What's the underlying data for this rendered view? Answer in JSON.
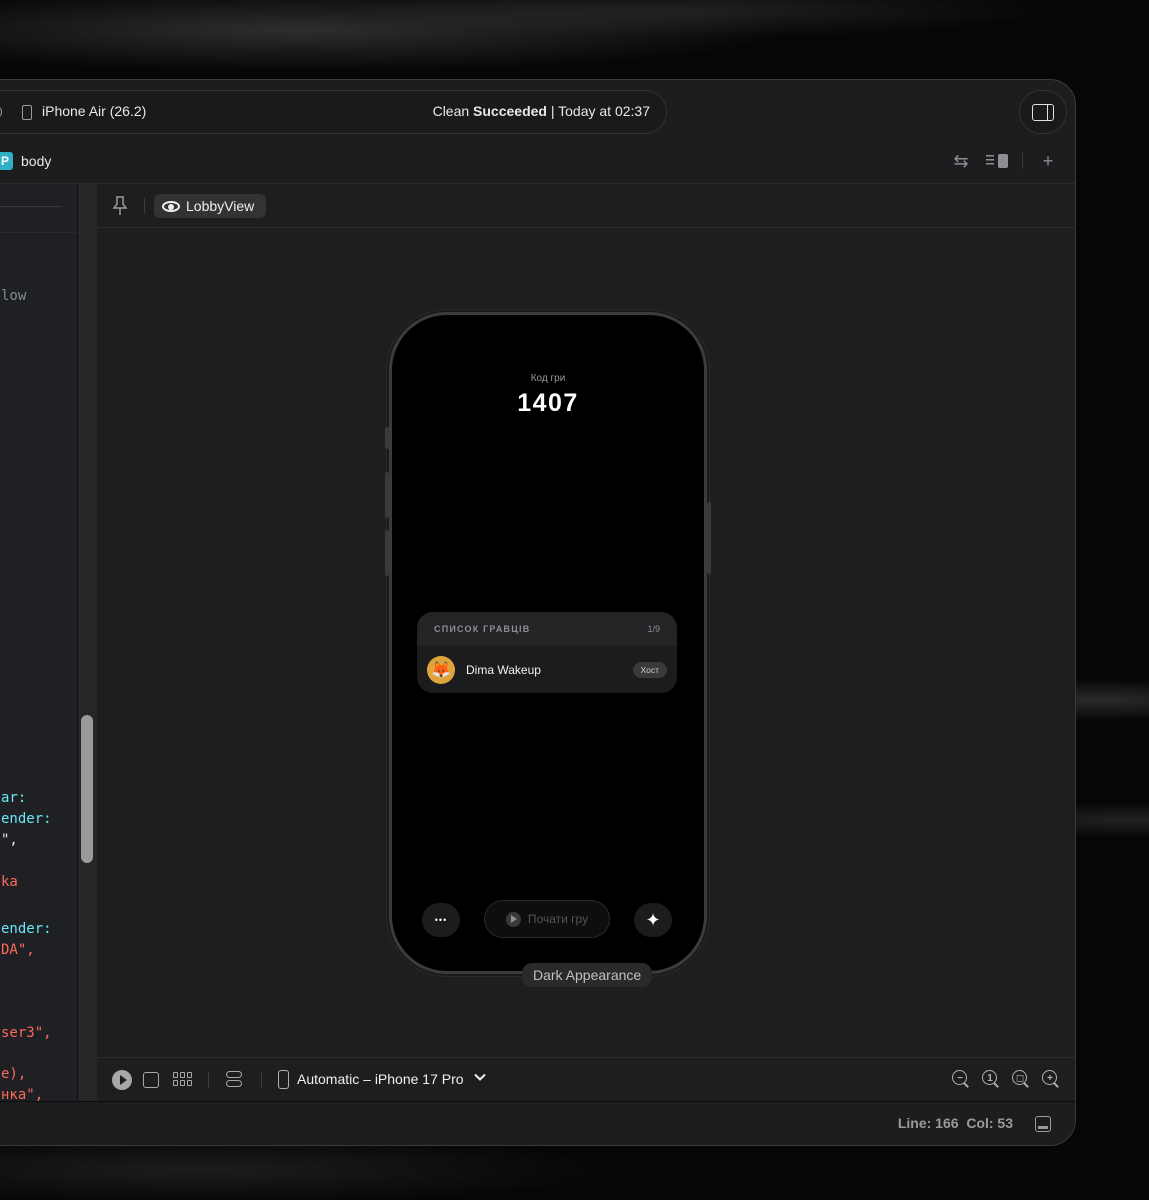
{
  "toolbar": {
    "destination": "iPhone Air (26.2)",
    "status_prefix": "Clean ",
    "status_bold": "Succeeded",
    "status_suffix": " | Today at 02:37"
  },
  "jumpbar": {
    "badge": "P",
    "item": "body"
  },
  "code_lines": [
    {
      "text": "low",
      "color": "gray"
    },
    {
      "text": "ar:",
      "color": "teal"
    },
    {
      "text": "ender:",
      "color": "teal"
    },
    {
      "text": "\",",
      "color": "red"
    },
    {
      "text": "ka",
      "color": "red"
    },
    {
      "text": "ender:",
      "color": "teal"
    },
    {
      "text": "DA\",",
      "color": "red"
    },
    {
      "text": "ser3\",",
      "color": "red"
    },
    {
      "text": "e),",
      "color": "red"
    },
    {
      "text": "нка\",",
      "color": "red"
    }
  ],
  "canvas": {
    "preview_name": "LobbyView",
    "appearance_label": "Dark Appearance",
    "device_selector": "Automatic – iPhone 17 Pro"
  },
  "phone": {
    "code_caption": "Код гри",
    "code_value": "1407",
    "players_title": "СПИСОК ГРАВЦІВ",
    "players_count": "1/9",
    "player_name": "Dima Wakeup",
    "player_avatar": "🦊",
    "host_badge": "Хост",
    "more_glyph": "•••",
    "start_label": "Почати гру",
    "sparkle_glyph": "✦"
  },
  "statusbar": {
    "position": "Line: 166  Col: 53"
  }
}
